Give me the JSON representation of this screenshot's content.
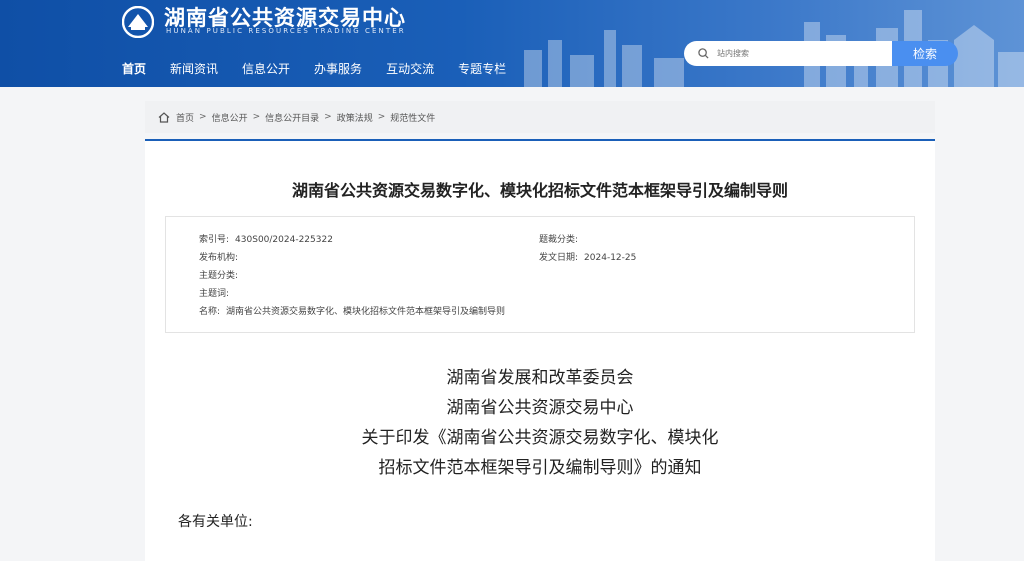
{
  "header": {
    "title": "湖南省公共资源交易中心",
    "subtitle": "HUNAN PUBLIC RESOURCES TRADING CENTER",
    "nav": [
      "首页",
      "新闻资讯",
      "信息公开",
      "办事服务",
      "互动交流",
      "专题专栏"
    ],
    "search_placeholder": "站内搜索",
    "search_button": "检索"
  },
  "breadcrumb": [
    "首页",
    "信息公开",
    "信息公开目录",
    "政策法规",
    "规范性文件"
  ],
  "breadcrumb_separator": ">",
  "article": {
    "title": "湖南省公共资源交易数字化、模块化招标文件范本框架导引及编制导则",
    "meta": {
      "index_label": "索引号:",
      "index_value": "430S00/2024-225322",
      "genre_label": "题裁分类:",
      "genre_value": "",
      "publisher_label": "发布机构:",
      "publisher_value": "",
      "date_label": "发文日期:",
      "date_value": "2024-12-25",
      "topic_label": "主题分类:",
      "topic_value": "",
      "keywords_label": "主题词:",
      "keywords_value": "",
      "name_label": "名称:",
      "name_value": "湖南省公共资源交易数字化、模块化招标文件范本框架导引及编制导则"
    },
    "heading_lines": [
      "湖南省发展和改革委员会",
      "湖南省公共资源交易中心",
      "关于印发《湖南省公共资源交易数字化、模块化",
      "招标文件范本框架导引及编制导则》的通知"
    ],
    "salutation": "各有关单位:"
  }
}
